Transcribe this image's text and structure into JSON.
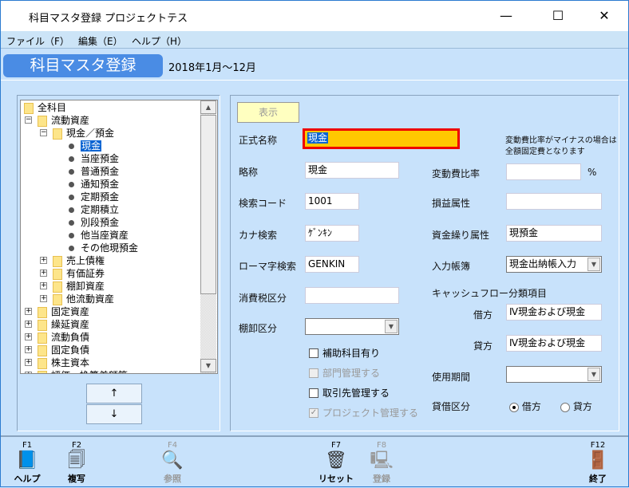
{
  "window": {
    "title": "科目マスタ登録 プロジェクトテス",
    "minimize": "—",
    "maximize": "☐",
    "close": "✕"
  },
  "menu": [
    {
      "label": "ファイル（F）"
    },
    {
      "label": "編集（E）"
    },
    {
      "label": "ヘルプ（H）"
    }
  ],
  "header": {
    "title": "科目マスタ登録",
    "period": "2018年1月～12月"
  },
  "tree": [
    {
      "label": "全科目",
      "level": 0,
      "type": "folder"
    },
    {
      "label": "流動資産",
      "level": 1,
      "type": "folder",
      "toggle": "−"
    },
    {
      "label": "現金／預金",
      "level": 2,
      "type": "folder",
      "toggle": "−"
    },
    {
      "label": "現金",
      "level": 3,
      "type": "leaf",
      "selected": true
    },
    {
      "label": "当座預金",
      "level": 3,
      "type": "leaf"
    },
    {
      "label": "普通預金",
      "level": 3,
      "type": "leaf"
    },
    {
      "label": "通知預金",
      "level": 3,
      "type": "leaf"
    },
    {
      "label": "定期預金",
      "level": 3,
      "type": "leaf"
    },
    {
      "label": "定期積立",
      "level": 3,
      "type": "leaf"
    },
    {
      "label": "別段預金",
      "level": 3,
      "type": "leaf"
    },
    {
      "label": "他当座資産",
      "level": 3,
      "type": "leaf"
    },
    {
      "label": "その他現預金",
      "level": 3,
      "type": "leaf"
    },
    {
      "label": "売上債権",
      "level": 2,
      "type": "folder",
      "toggle": "+"
    },
    {
      "label": "有価証券",
      "level": 2,
      "type": "folder",
      "toggle": "+"
    },
    {
      "label": "棚卸資産",
      "level": 2,
      "type": "folder",
      "toggle": "+"
    },
    {
      "label": "他流動資産",
      "level": 2,
      "type": "folder",
      "toggle": "+"
    },
    {
      "label": "固定資産",
      "level": 1,
      "type": "folder",
      "toggle": "+"
    },
    {
      "label": "繰延資産",
      "level": 1,
      "type": "folder",
      "toggle": "+"
    },
    {
      "label": "流動負債",
      "level": 1,
      "type": "folder",
      "toggle": "+"
    },
    {
      "label": "固定負債",
      "level": 1,
      "type": "folder",
      "toggle": "+"
    },
    {
      "label": "株主資本",
      "level": 1,
      "type": "folder",
      "toggle": "+"
    },
    {
      "label": "評価・換算差額等",
      "level": 1,
      "type": "folder",
      "toggle": "+"
    }
  ],
  "move": {
    "up": "↑",
    "down": "↓"
  },
  "form": {
    "show_button": "表示",
    "official_name": {
      "label": "正式名称",
      "value": "現金"
    },
    "note": "変動費比率がマイナスの場合は\n全額固定費となります",
    "short_name": {
      "label": "略称",
      "value": "現金"
    },
    "search_code": {
      "label": "検索コード",
      "value": "1001"
    },
    "kana": {
      "label": "カナ検索",
      "value": "ｹﾞﾝｷﾝ"
    },
    "romaji": {
      "label": "ローマ字検索",
      "value": "GENKIN"
    },
    "tax": {
      "label": "消費税区分",
      "value": ""
    },
    "inventory": {
      "label": "棚卸区分",
      "value": ""
    },
    "variable_ratio": {
      "label": "変動費比率",
      "value": "",
      "unit": "%"
    },
    "pl_attr": {
      "label": "損益属性",
      "value": ""
    },
    "fund_attr": {
      "label": "資金繰り属性",
      "value": "現預金"
    },
    "book": {
      "label": "入力帳簿",
      "value": "現金出納帳入力"
    },
    "cashflow": {
      "label": "キャッシュフロー分類項目",
      "debit_label": "借方",
      "debit": "Ⅳ現金および現金",
      "credit_label": "貸方",
      "credit": "Ⅳ現金および現金"
    },
    "period": {
      "label": "使用期間",
      "value": ""
    },
    "dc": {
      "label": "貸借区分",
      "debit": "借方",
      "credit": "貸方",
      "selected": "借方"
    },
    "checks": [
      {
        "label": "補助科目有り",
        "checked": false,
        "disabled": false
      },
      {
        "label": "部門管理する",
        "checked": false,
        "disabled": true
      },
      {
        "label": "取引先管理する",
        "checked": false,
        "disabled": false
      },
      {
        "label": "プロジェクト管理する",
        "checked": true,
        "disabled": true
      }
    ]
  },
  "toolbar": [
    {
      "key": "F1",
      "label": "ヘルプ",
      "icon": "help-book-icon",
      "enabled": true
    },
    {
      "key": "F2",
      "label": "複写",
      "icon": "copy-icon",
      "enabled": true
    },
    {
      "key": "F4",
      "label": "参照",
      "icon": "magnifier-icon",
      "enabled": false
    },
    {
      "key": "F7",
      "label": "リセット",
      "icon": "trash-icon",
      "enabled": true
    },
    {
      "key": "F8",
      "label": "登録",
      "icon": "computer-icon",
      "enabled": false
    },
    {
      "key": "F12",
      "label": "終了",
      "icon": "door-icon",
      "enabled": true
    }
  ]
}
